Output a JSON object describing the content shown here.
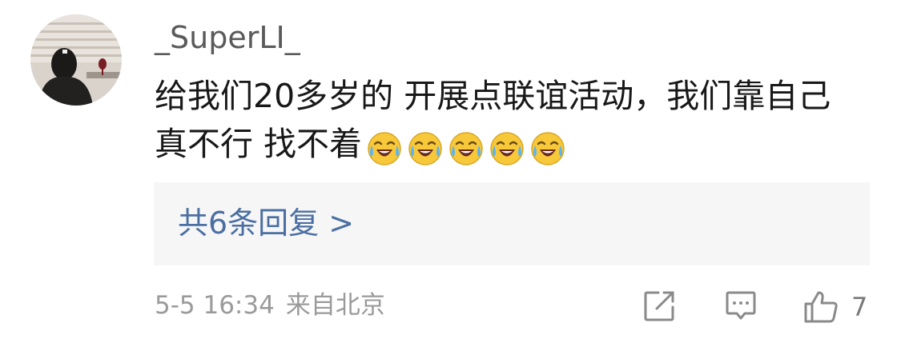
{
  "comment": {
    "username": "_SuperLI_",
    "content_line1": "给我们20多岁的 开展点联谊活动，我们靠自己",
    "content_line2": "真不行 找不着",
    "emojis": [
      "laugh-cry-icon",
      "laugh-cry-icon",
      "laugh-cry-icon",
      "laugh-cry-icon",
      "laugh-cry-icon"
    ],
    "replies_label": "共6条回复 >",
    "timestamp": "5-5 16:34",
    "location": "来自北京",
    "like_count": "7"
  },
  "colors": {
    "username": "#5a5a5a",
    "text": "#181818",
    "link": "#4b6fa3",
    "meta": "#9a9a9a",
    "reply_bg": "#f6f6f6"
  }
}
